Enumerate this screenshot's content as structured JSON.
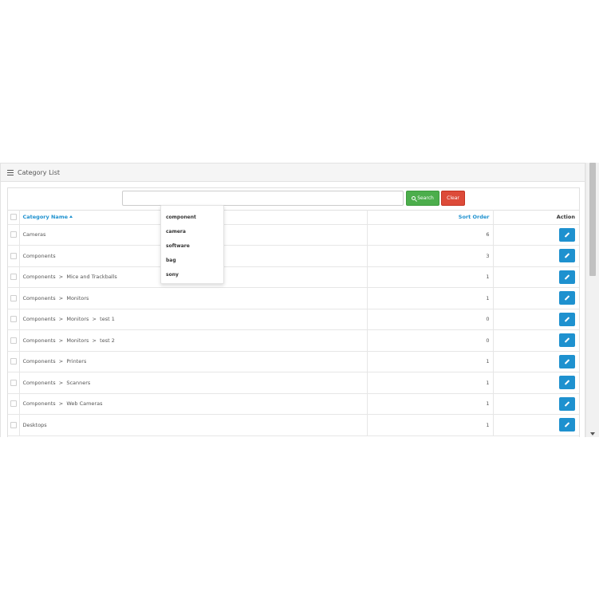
{
  "panel": {
    "title": "Category List"
  },
  "search": {
    "value": "",
    "placeholder": "",
    "search_label": "Search",
    "clear_label": "Clear"
  },
  "table": {
    "headers": {
      "name": "Category Name",
      "sort_order": "Sort Order",
      "action": "Action"
    },
    "rows": [
      {
        "name": "Cameras",
        "sort_order": "6"
      },
      {
        "name": "Components",
        "sort_order": "3"
      },
      {
        "name": "Components  >  Mice and Trackballs",
        "sort_order": "1"
      },
      {
        "name": "Components  >  Monitors",
        "sort_order": "1"
      },
      {
        "name": "Components  >  Monitors  >  test 1",
        "sort_order": "0"
      },
      {
        "name": "Components  >  Monitors  >  test 2",
        "sort_order": "0"
      },
      {
        "name": "Components  >  Printers",
        "sort_order": "1"
      },
      {
        "name": "Components  >  Scanners",
        "sort_order": "1"
      },
      {
        "name": "Components  >  Web Cameras",
        "sort_order": "1"
      },
      {
        "name": "Desktops",
        "sort_order": "1"
      }
    ]
  },
  "autocomplete": {
    "items": [
      "component",
      "camera",
      "software",
      "bag",
      "sony"
    ]
  },
  "colors": {
    "primary": "#1e91cf",
    "success": "#4cae4c",
    "danger": "#dd4b39"
  },
  "icons": {
    "panel": "list-icon",
    "search": "search-icon",
    "edit": "pencil-icon",
    "sort": "caret-up-icon"
  }
}
